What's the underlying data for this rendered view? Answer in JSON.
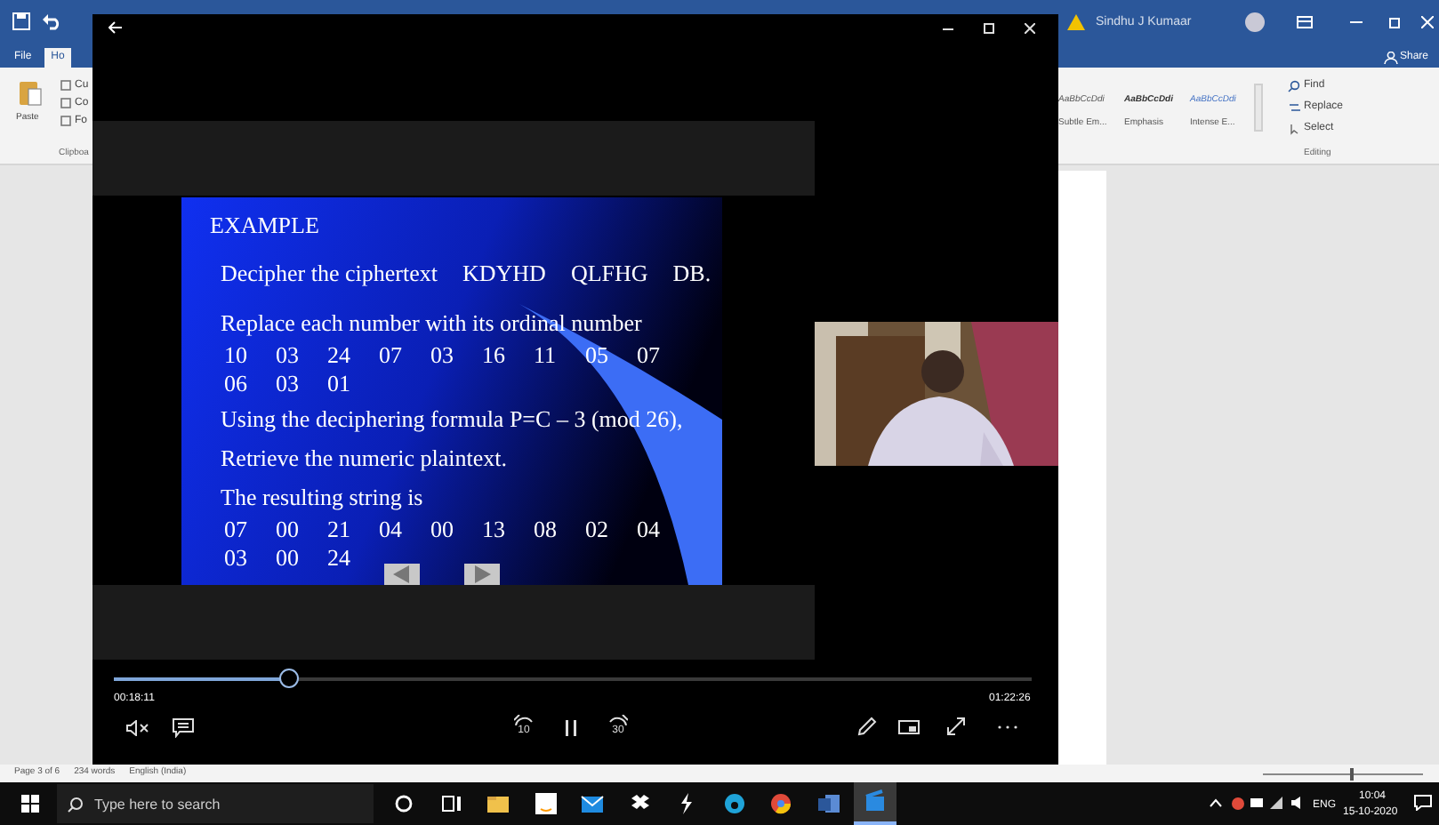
{
  "word": {
    "tabs": [
      {
        "label": "File",
        "selected": false
      },
      {
        "label": "Ho",
        "selected": true
      }
    ],
    "clipboard": {
      "paste": "Paste",
      "items": [
        "Cu",
        "Co",
        "Fo"
      ],
      "group": "Clipboa"
    },
    "account": {
      "user": "Sindhu J Kumaar"
    },
    "share": "Share",
    "styles": [
      {
        "sample": "AaBbCcDdi",
        "name": "Subtle Em...",
        "kind": "subtle"
      },
      {
        "sample": "AaBbCcDdi",
        "name": "Emphasis",
        "kind": "emphasis"
      },
      {
        "sample": "AaBbCcDdi",
        "name": "Intense E...",
        "kind": "intense"
      }
    ],
    "editing": {
      "items": [
        {
          "label": "Find",
          "kind": "find"
        },
        {
          "label": "Replace",
          "kind": "replace"
        },
        {
          "label": "Select",
          "kind": "select"
        }
      ],
      "group": "Editing"
    },
    "status_bar": [
      "Page 3 of 6",
      "234 words",
      "English (India)"
    ],
    "zoom": {
      "level": 0.55
    }
  },
  "player": {
    "slide": {
      "title": "EXAMPLE",
      "lines": [
        {
          "kind": "cipher",
          "parts": [
            "Decipher the ciphertext",
            "KDYHD",
            "QLFHG",
            "DB."
          ]
        },
        {
          "kind": "text",
          "text": "Replace each number with its ordinal number"
        },
        {
          "kind": "numbers",
          "values": [
            "10",
            "03",
            "24",
            "07",
            "03",
            "16",
            "11",
            "05",
            "07",
            "06",
            "03",
            "01"
          ]
        },
        {
          "kind": "text",
          "text": "Using the deciphering formula P=C – 3 (mod 26),"
        },
        {
          "kind": "text",
          "text": "Retrieve the numeric plaintext."
        },
        {
          "kind": "text",
          "text": "The resulting string is"
        },
        {
          "kind": "numbers",
          "values": [
            "07",
            "00",
            "21",
            "04",
            "00",
            "13",
            "08",
            "02",
            "04",
            "03",
            "00",
            "24"
          ]
        }
      ]
    },
    "progress": {
      "level": 0.19,
      "elapsed": "00:18:11",
      "total": "01:22:26"
    },
    "skip_back": "10",
    "skip_forward": "30"
  },
  "taskbar": {
    "search_placeholder": "Type here to search",
    "apps": [
      {
        "kind": "cortana",
        "active": false
      },
      {
        "kind": "taskview",
        "active": false
      },
      {
        "kind": "explorer",
        "active": false
      },
      {
        "kind": "amazon",
        "active": false
      },
      {
        "kind": "mail",
        "active": false
      },
      {
        "kind": "dropbox",
        "active": false
      },
      {
        "kind": "bolt",
        "active": false
      },
      {
        "kind": "edge",
        "active": false
      },
      {
        "kind": "chrome",
        "active": false
      },
      {
        "kind": "word",
        "active": false
      },
      {
        "kind": "movies",
        "active": true
      }
    ],
    "language": "ENG",
    "time": "10:04",
    "date": "15-10-2020"
  }
}
